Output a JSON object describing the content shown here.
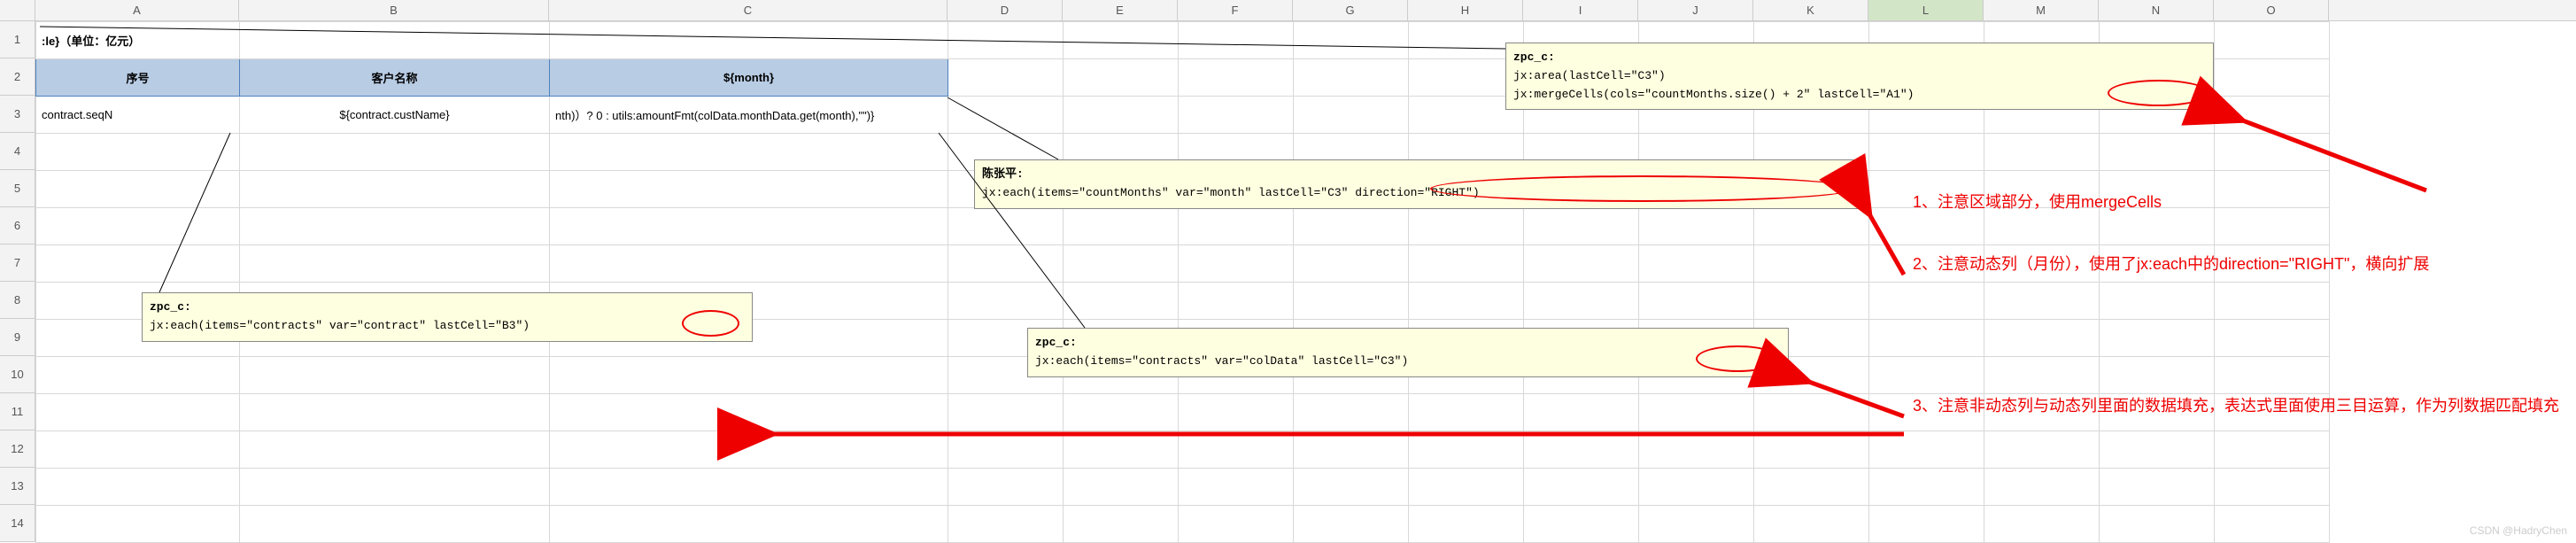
{
  "columns": {
    "letters": [
      "A",
      "B",
      "C",
      "D",
      "E",
      "F",
      "G",
      "H",
      "I",
      "J",
      "K",
      "L",
      "M",
      "N",
      "O"
    ],
    "widths": [
      230,
      350,
      450,
      130,
      130,
      130,
      130,
      130,
      130,
      130,
      130,
      130,
      130,
      130,
      130
    ],
    "selected": "L"
  },
  "rows": {
    "count": 14,
    "height": 42
  },
  "cells": {
    "A1": ":le}（单位：亿元）",
    "A2": "序号",
    "B2": "客户名称",
    "C2": "${month}",
    "A3": "contract.seqN",
    "B3": "${contract.custName}",
    "C3": "nth)）? 0 : utils:amountFmt(colData.monthData.get(month),\"\")}"
  },
  "comments": {
    "c1": {
      "author": "zpc_c:",
      "lines": [
        "jx:area(lastCell=\"C3\")",
        "jx:mergeCells(cols=\"countMonths.size() + 2\" lastCell=\"A1\")"
      ]
    },
    "c2": {
      "author": "陈张平:",
      "lines": [
        "jx:each(items=\"countMonths\" var=\"month\" lastCell=\"C3\" direction=\"RIGHT\")"
      ]
    },
    "c3": {
      "author": "zpc_c:",
      "lines": [
        "jx:each(items=\"contracts\" var=\"contract\" lastCell=\"B3\")"
      ]
    },
    "c4": {
      "author": "zpc_c:",
      "lines": [
        "jx:each(items=\"contracts\" var=\"colData\" lastCell=\"C3\")"
      ]
    }
  },
  "notes": {
    "n1": "1、注意区域部分，使用mergeCells",
    "n2": "2、注意动态列（月份），使用了jx:each中的direction=\"RIGHT\"，横向扩展",
    "n3": "3、注意非动态列与动态列里面的数据填充，表达式里面使用三目运算，作为列数据匹配填充"
  },
  "watermark": "CSDN @HadryChen"
}
